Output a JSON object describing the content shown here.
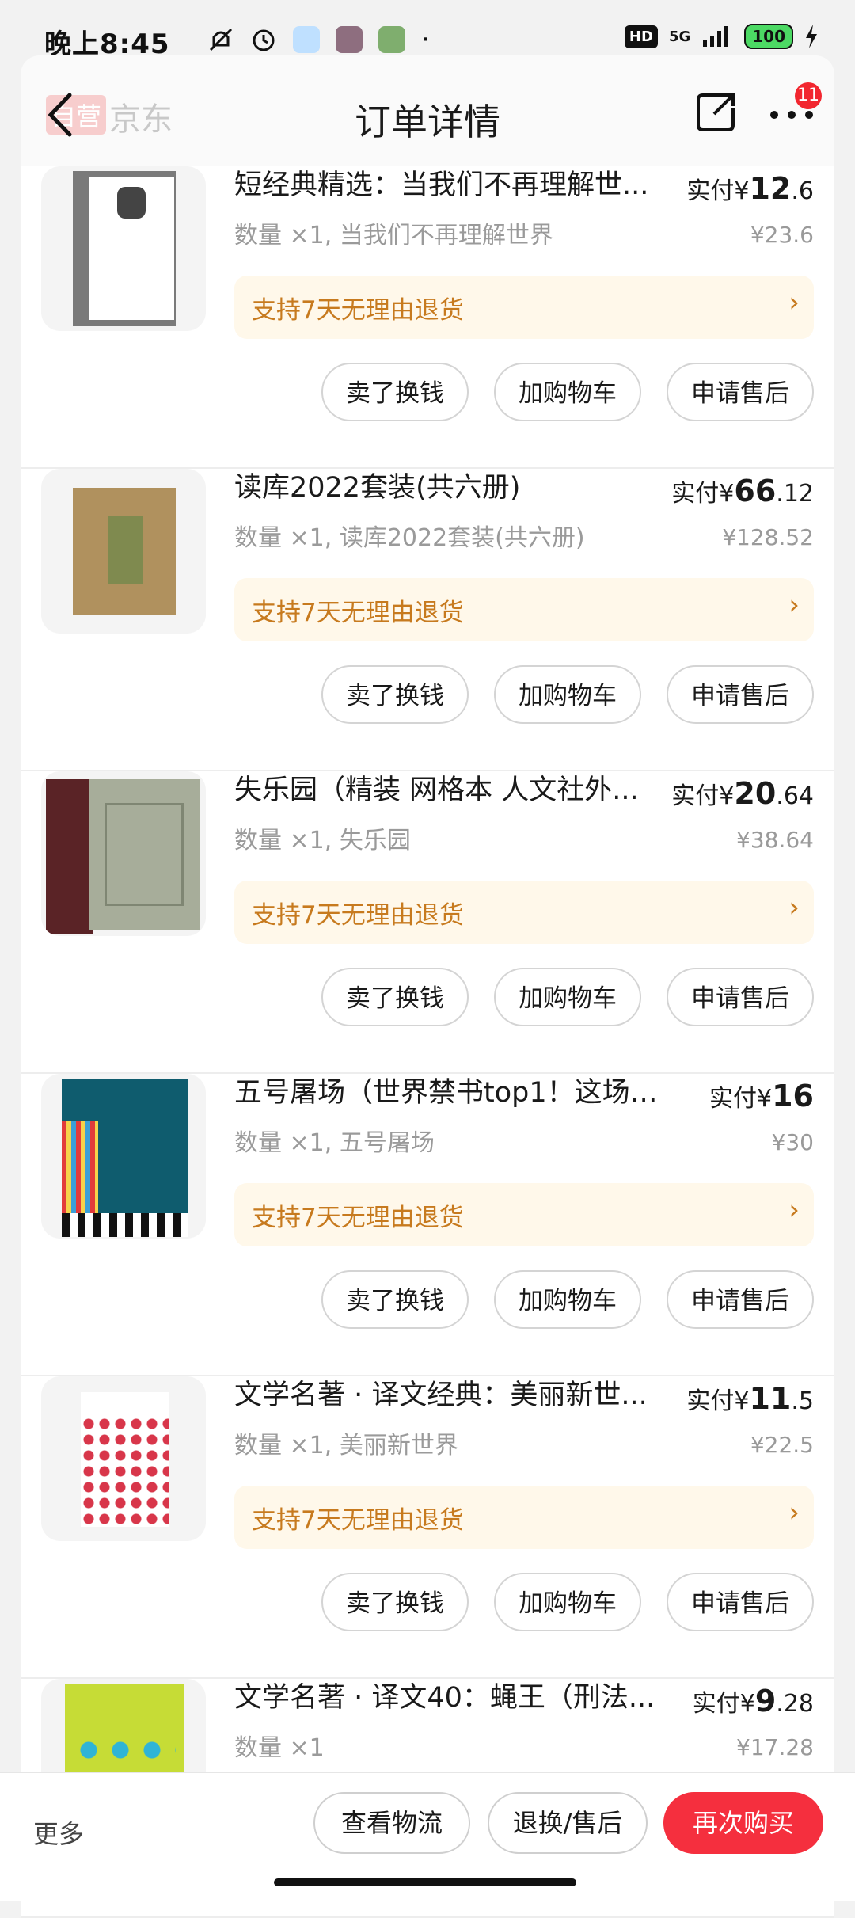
{
  "status": {
    "time": "晚上8:45",
    "network": "5G",
    "hd": "HD",
    "battery": "100"
  },
  "header": {
    "ghost_tag": "自营",
    "ghost_store": "京东",
    "title": "订单详情",
    "badge": "11"
  },
  "items": [
    {
      "name": "短经典精选：当我们不再理解世...",
      "qty": "数量 ×1, 当我们不再理解世界",
      "paid_prefix": "实付¥",
      "paid_int": "12",
      "paid_dec": ".6",
      "orig": "¥23.6",
      "return": "支持7天无理由退货"
    },
    {
      "name": "读库2022套装(共六册)",
      "qty": "数量 ×1, 读库2022套装(共六册)",
      "paid_prefix": "实付¥",
      "paid_int": "66",
      "paid_dec": ".12",
      "orig": "¥128.52",
      "return": "支持7天无理由退货"
    },
    {
      "name": "失乐园（精装 网格本 人文社外...",
      "qty": "数量 ×1, 失乐园",
      "paid_prefix": "实付¥",
      "paid_int": "20",
      "paid_dec": ".64",
      "orig": "¥38.64",
      "return": "支持7天无理由退货"
    },
    {
      "name": "五号屠场（世界禁书top1！这场灾...",
      "qty": "数量 ×1, 五号屠场",
      "paid_prefix": "实付¥",
      "paid_int": "16",
      "paid_dec": "",
      "orig": "¥30",
      "return": "支持7天无理由退货"
    },
    {
      "name": "文学名著 · 译文经典：美丽新世...",
      "qty": "数量 ×1, 美丽新世界",
      "paid_prefix": "实付¥",
      "paid_int": "11",
      "paid_dec": ".5",
      "orig": "¥22.5",
      "return": "支持7天无理由退货"
    },
    {
      "name": "文学名著 · 译文40：蝇王（刑法...",
      "qty": "数量 ×1",
      "paid_prefix": "实付¥",
      "paid_int": "9",
      "paid_dec": ".28",
      "orig": "¥17.28",
      "return": ""
    }
  ],
  "item_buttons": {
    "sell": "卖了换钱",
    "cart": "加购物车",
    "after_sale": "申请售后"
  },
  "bottom": {
    "more": "更多",
    "logistics": "查看物流",
    "return_service": "退换/售后",
    "buy_again": "再次购买"
  },
  "colors": {
    "accent_red": "#f52f3e",
    "return_text": "#c77a1e",
    "return_bg": "#fff8ea"
  }
}
